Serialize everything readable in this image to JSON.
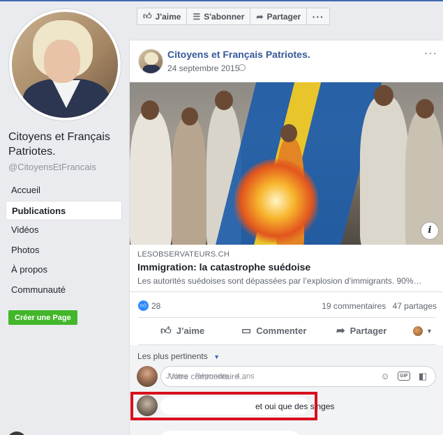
{
  "page": {
    "name": "Citoyens et Français Patriotes.",
    "handle": "@CitoyensEtFrancais",
    "nav": [
      {
        "label": "Accueil",
        "active": false
      },
      {
        "label": "Publications",
        "active": true
      },
      {
        "label": "Vidéos",
        "active": false
      },
      {
        "label": "Photos",
        "active": false
      },
      {
        "label": "À propos",
        "active": false
      },
      {
        "label": "Communauté",
        "active": false
      }
    ],
    "create_page_label": "Créer une Page"
  },
  "action_bar": {
    "like_label": "J'aime",
    "subscribe_label": "S'abonner",
    "share_label": "Partager",
    "more_label": "···"
  },
  "post": {
    "author": "Citoyens et Français Patriotes.",
    "date": "24 septembre 2015",
    "more_label": "···",
    "info_label": "i",
    "link": {
      "domain": "LESOBSERVATEURS.CH",
      "title": "Immigration: la catastrophe suédoise",
      "description": "Les autorités suédoises sont dépassées par l’explosion d’immigrants. 90%…"
    },
    "stats": {
      "likes": "28",
      "comments": "19 commentaires",
      "shares": "47 partages"
    },
    "actions": {
      "like": "J’aime",
      "comment": "Commenter",
      "share": "Partager"
    }
  },
  "comments": {
    "sort_label": "Les plus pertinents",
    "input_placeholder": "Votre commentaire...",
    "gif_label": "GIF",
    "items": [
      {
        "text": "et oui que des singes",
        "meta": [
          "J’aime",
          "Répondre",
          "4 ans"
        ]
      }
    ]
  },
  "colors": {
    "link_blue": "#365899",
    "fb_blue": "#4267b2",
    "like_blue": "#2d88ff",
    "create_green": "#42b72a",
    "highlight_red": "#d90f1d"
  }
}
